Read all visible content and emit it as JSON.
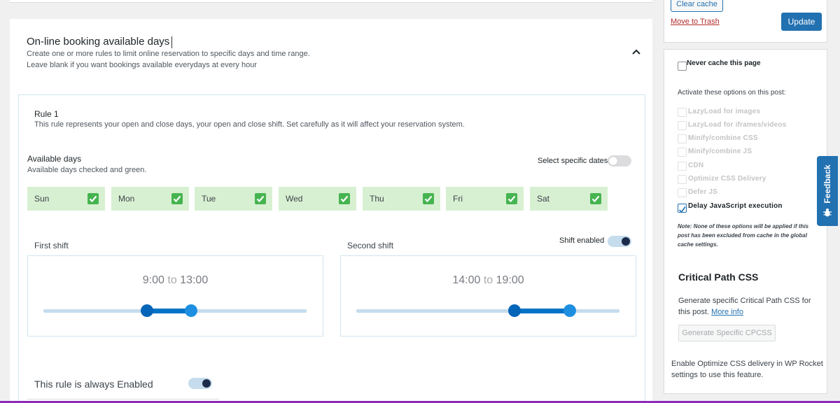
{
  "booking": {
    "title": "On-line booking available days",
    "description_line1": "Create one or more rules to limit online reservation to specific days and time range.",
    "description_line2": "Leave blank if you want bookings available everydays at every hour"
  },
  "rule": {
    "title": "Rule 1",
    "description": "This rule represents your open and close days, your open and close shift. Set carefully as it will affect your reservation system.",
    "available_days_title": "Available days",
    "available_days_sub": "Available days checked and green.",
    "select_specific_dates": "Select specific dates",
    "select_specific_dates_enabled": false,
    "days": [
      {
        "label": "Sun",
        "checked": true
      },
      {
        "label": "Mon",
        "checked": true
      },
      {
        "label": "Tue",
        "checked": true
      },
      {
        "label": "Wed",
        "checked": true
      },
      {
        "label": "Thu",
        "checked": true
      },
      {
        "label": "Fri",
        "checked": true
      },
      {
        "label": "Sat",
        "checked": true
      }
    ],
    "first_shift": {
      "label": "First shift",
      "start": "9:00",
      "to": "to",
      "end": "13:00"
    },
    "second_shift": {
      "label": "Second shift",
      "start": "14:00",
      "to": "to",
      "end": "19:00",
      "toggle_label": "Shift enabled",
      "enabled": true
    },
    "always_enabled_label": "This rule is always Enabled",
    "always_enabled": true
  },
  "sidebar": {
    "clear_cache": "Clear cache",
    "move_to_trash": "Move to Trash",
    "update": "Update",
    "never_cache": "Never cache this page",
    "activate_label": "Activate these options on this post:",
    "options": [
      {
        "label": "LazyLoad for images",
        "enabled": false,
        "checked": false
      },
      {
        "label": "LazyLoad for iframes/videos",
        "enabled": false,
        "checked": false
      },
      {
        "label": "Minify/combine CSS",
        "enabled": false,
        "checked": false
      },
      {
        "label": "Minify/combine JS",
        "enabled": false,
        "checked": false
      },
      {
        "label": "CDN",
        "enabled": false,
        "checked": false
      },
      {
        "label": "Optimize CSS Delivery",
        "enabled": false,
        "checked": false
      },
      {
        "label": "Defer JS",
        "enabled": false,
        "checked": false
      },
      {
        "label": "Delay JavaScript execution",
        "enabled": true,
        "checked": true
      }
    ],
    "note": "Note: None of these options will be applied if this post has been excluded from cache in the global cache settings.",
    "cpcss_title": "Critical Path CSS",
    "cpcss_desc": "Generate specific Critical Path CSS for this post.",
    "cpcss_more": "More info",
    "cpcss_button": "Generate Specific CPCSS",
    "cpcss_note": "Enable Optimize CSS delivery in WP Rocket settings to use this feature."
  },
  "feedback": "Feedback",
  "colors": {
    "accent": "#2271b1",
    "day_bg": "#d8f0d2",
    "check_green": "#46b450",
    "slider_range": "#0073c6",
    "bottom_bar": "#8e2ab8"
  }
}
